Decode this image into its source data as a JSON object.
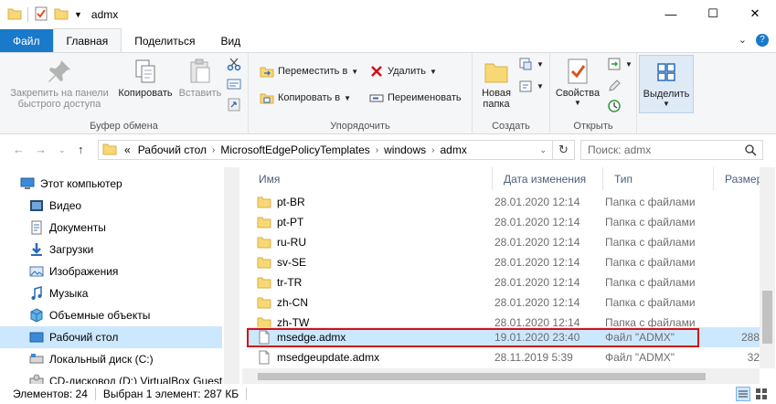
{
  "window": {
    "title": "admx",
    "minimize": "—",
    "maximize": "☐",
    "close": "✕"
  },
  "ribbon_tabs": [
    {
      "label": "Файл"
    },
    {
      "label": "Главная"
    },
    {
      "label": "Поделиться"
    },
    {
      "label": "Вид"
    }
  ],
  "ribbon": {
    "clipboard": {
      "group_label": "Буфер обмена",
      "pin_label": "Закрепить на панели быстрого доступа",
      "pin_line1": "Закрепить на панели",
      "pin_line2": "быстрого доступа",
      "copy_label": "Копировать",
      "paste_label": "Вставить"
    },
    "organize": {
      "group_label": "Упорядочить",
      "move_label": "Переместить в",
      "copy_to_label": "Копировать в",
      "delete_label": "Удалить",
      "rename_label": "Переименовать"
    },
    "new": {
      "group_label": "Создать",
      "new_folder_line1": "Новая",
      "new_folder_line2": "папка"
    },
    "open": {
      "group_label": "Открыть",
      "properties_label": "Свойства"
    },
    "select": {
      "select_label": "Выделить"
    }
  },
  "address": {
    "crumbs": [
      "«",
      "Рабочий стол",
      "MicrosoftEdgePolicyTemplates",
      "windows",
      "admx"
    ],
    "search_placeholder": "Поиск: admx"
  },
  "nav_items": [
    {
      "label": "Этот компьютер",
      "icon": "computer-icon",
      "indent": 0
    },
    {
      "label": "Видео",
      "icon": "video-icon",
      "indent": 1
    },
    {
      "label": "Документы",
      "icon": "documents-icon",
      "indent": 1
    },
    {
      "label": "Загрузки",
      "icon": "downloads-icon",
      "indent": 1
    },
    {
      "label": "Изображения",
      "icon": "pictures-icon",
      "indent": 1
    },
    {
      "label": "Музыка",
      "icon": "music-icon",
      "indent": 1
    },
    {
      "label": "Объемные объекты",
      "icon": "3d-objects-icon",
      "indent": 1
    },
    {
      "label": "Рабочий стол",
      "icon": "desktop-icon",
      "indent": 1,
      "selected": true
    },
    {
      "label": "Локальный диск (C:)",
      "icon": "drive-icon",
      "indent": 1
    },
    {
      "label": "CD-дисковод (D:) VirtualBox Guest",
      "icon": "cd-drive-icon",
      "indent": 1
    }
  ],
  "columns": [
    {
      "label": "Имя"
    },
    {
      "label": "Дата изменения"
    },
    {
      "label": "Тип"
    },
    {
      "label": "Размер"
    }
  ],
  "files": [
    {
      "name": "pt-BR",
      "date": "28.01.2020 12:14",
      "type": "Папка с файлами",
      "size": "",
      "kind": "folder"
    },
    {
      "name": "pt-PT",
      "date": "28.01.2020 12:14",
      "type": "Папка с файлами",
      "size": "",
      "kind": "folder"
    },
    {
      "name": "ru-RU",
      "date": "28.01.2020 12:14",
      "type": "Папка с файлами",
      "size": "",
      "kind": "folder"
    },
    {
      "name": "sv-SE",
      "date": "28.01.2020 12:14",
      "type": "Папка с файлами",
      "size": "",
      "kind": "folder"
    },
    {
      "name": "tr-TR",
      "date": "28.01.2020 12:14",
      "type": "Папка с файлами",
      "size": "",
      "kind": "folder"
    },
    {
      "name": "zh-CN",
      "date": "28.01.2020 12:14",
      "type": "Папка с файлами",
      "size": "",
      "kind": "folder"
    },
    {
      "name": "zh-TW",
      "date": "28.01.2020 12:14",
      "type": "Папка с файлами",
      "size": "",
      "kind": "folder"
    },
    {
      "name": "msedge.admx",
      "date": "19.01.2020 23:40",
      "type": "Файл \"ADMX\"",
      "size": "288",
      "kind": "file",
      "selected": true
    },
    {
      "name": "msedgeupdate.admx",
      "date": "28.11.2019 5:39",
      "type": "Файл \"ADMX\"",
      "size": "32",
      "kind": "file"
    }
  ],
  "status": {
    "count": "Элементов: 24",
    "selection": "Выбран 1 элемент: 287 КБ"
  },
  "colors": {
    "accent": "#1979ca",
    "selection": "#cce8ff",
    "highlight_border": "#d0121b",
    "folder": "#f8d775"
  }
}
